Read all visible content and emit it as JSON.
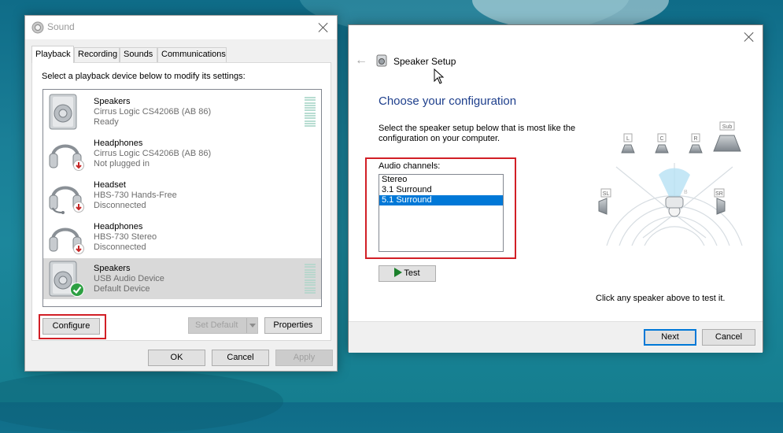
{
  "sound_dialog": {
    "title": "Sound",
    "tabs": [
      {
        "label": "Playback",
        "active": true
      },
      {
        "label": "Recording",
        "active": false
      },
      {
        "label": "Sounds",
        "active": false
      },
      {
        "label": "Communications",
        "active": false
      }
    ],
    "instruction": "Select a playback device below to modify its settings:",
    "devices": [
      {
        "name": "Speakers",
        "detail": "Cirrus Logic CS4206B (AB 86)",
        "status": "Ready",
        "icon": "speaker-icon",
        "overlay": "",
        "selected": false
      },
      {
        "name": "Headphones",
        "detail": "Cirrus Logic CS4206B (AB 86)",
        "status": "Not plugged in",
        "icon": "headphones-icon",
        "overlay": "unplugged-badge-icon",
        "selected": false
      },
      {
        "name": "Headset",
        "detail": "HBS-730 Hands-Free",
        "status": "Disconnected",
        "icon": "headset-icon",
        "overlay": "disconnected-badge-icon",
        "selected": false
      },
      {
        "name": "Headphones",
        "detail": "HBS-730 Stereo",
        "status": "Disconnected",
        "icon": "headphones-icon",
        "overlay": "disconnected-badge-icon",
        "selected": false
      },
      {
        "name": "Speakers",
        "detail": "USB Audio Device",
        "status": "Default Device",
        "icon": "speaker-icon",
        "overlay": "default-check-icon",
        "selected": true
      }
    ],
    "buttons": {
      "configure": "Configure",
      "set_default": "Set Default",
      "properties": "Properties",
      "ok": "OK",
      "cancel": "Cancel",
      "apply": "Apply"
    }
  },
  "speaker_setup": {
    "title": "Speaker Setup",
    "heading": "Choose your configuration",
    "description": "Select the speaker setup below that is most like the configuration on your computer.",
    "channels_label": "Audio channels:",
    "channels": [
      {
        "label": "Stereo",
        "selected": false
      },
      {
        "label": "3.1 Surround",
        "selected": false
      },
      {
        "label": "5.1 Surround",
        "selected": true
      }
    ],
    "test_button": "Test",
    "hint": "Click any speaker above to test it.",
    "speaker_labels": {
      "L": "L",
      "C": "C",
      "R": "R",
      "Sub": "Sub",
      "SL": "SL",
      "SR": "SR"
    },
    "buttons": {
      "next": "Next",
      "cancel": "Cancel"
    }
  },
  "colors": {
    "highlight_box": "#d21f26",
    "selection": "#0078d7",
    "heading": "#1e3f8c"
  }
}
